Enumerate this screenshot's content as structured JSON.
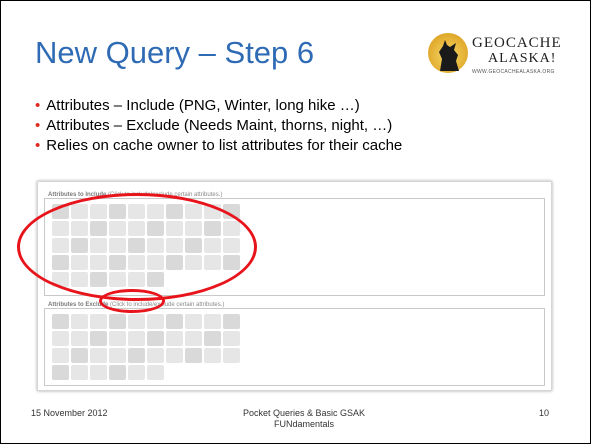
{
  "slide": {
    "title": "New Query – Step 6",
    "logo": {
      "line1": "GEOCACHE",
      "line2": "ALASKA!",
      "url": "WWW.GEOCACHEALASKA.ORG",
      "icon": "howling-wolf-icon"
    },
    "bullets": [
      "Attributes – Include (PNG, Winter, long hike …)",
      "Attributes – Exclude (Needs Maint, thorns, night, …)",
      "Relies on cache owner to list attributes for their cache"
    ],
    "screenshot": {
      "include_label_bold": "Attributes to Include",
      "include_label_note": "(Click to include/exclude certain attributes.)",
      "exclude_label_bold": "Attributes to Exclude",
      "exclude_label_note": "(Click to include/exclude certain attributes.)"
    },
    "footer": {
      "date": "15 November  2012",
      "title": "Pocket Queries & Basic GSAK FUNdamentals",
      "page": "10"
    },
    "colors": {
      "title": "#2f6bb5",
      "bullet": "#e02b20",
      "highlight": "#e8141b"
    }
  }
}
